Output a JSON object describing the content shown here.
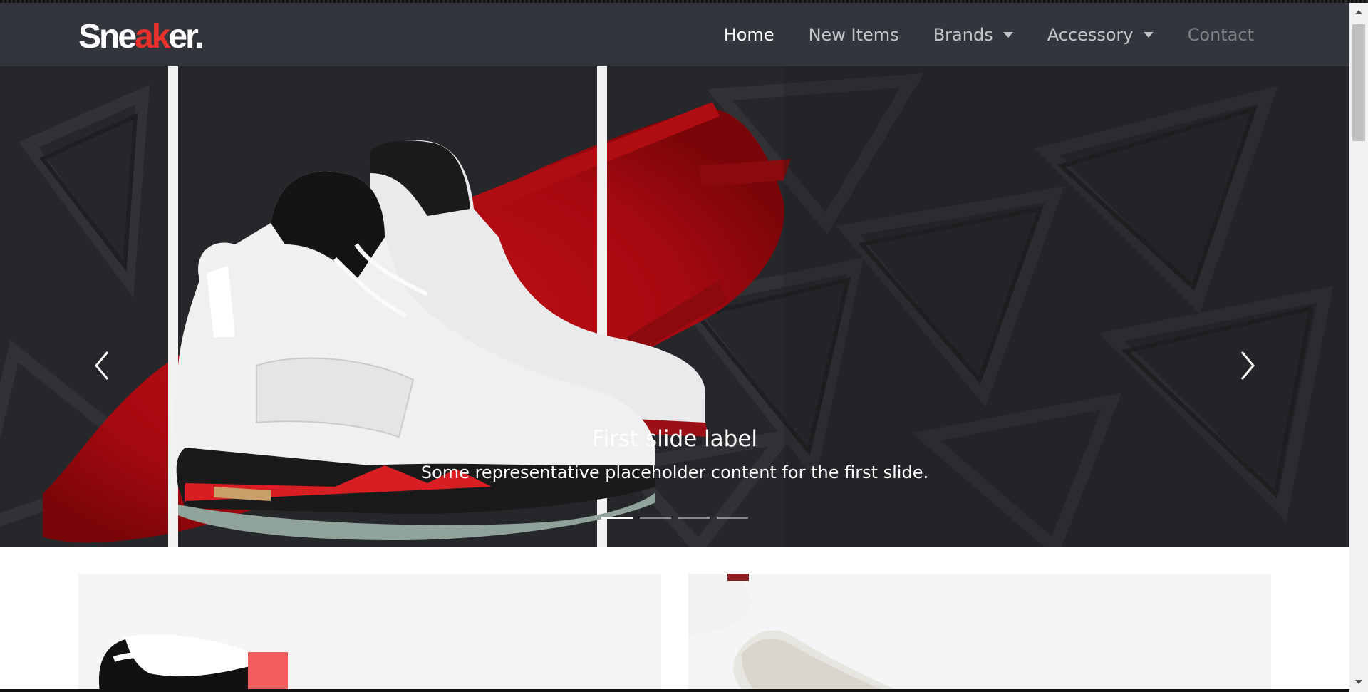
{
  "brand": {
    "part1": "Sne",
    "part2": "ak",
    "part3": "er."
  },
  "nav": {
    "home": "Home",
    "new_items": "New Items",
    "brands": "Brands",
    "accessory": "Accessory",
    "contact": "Contact"
  },
  "carousel": {
    "title": "First slide label",
    "text": "Some representative placeholder content for the first slide.",
    "slide_count": 4,
    "active_slide": 1
  },
  "colors": {
    "navbar": "#32363c",
    "accent": "#e8312a",
    "hero_bg": "#26272b",
    "card_bg": "#f4f5f7"
  },
  "icons": {
    "prev": "chevron-left-icon",
    "next": "chevron-right-icon",
    "dropdown": "caret-down-icon"
  }
}
